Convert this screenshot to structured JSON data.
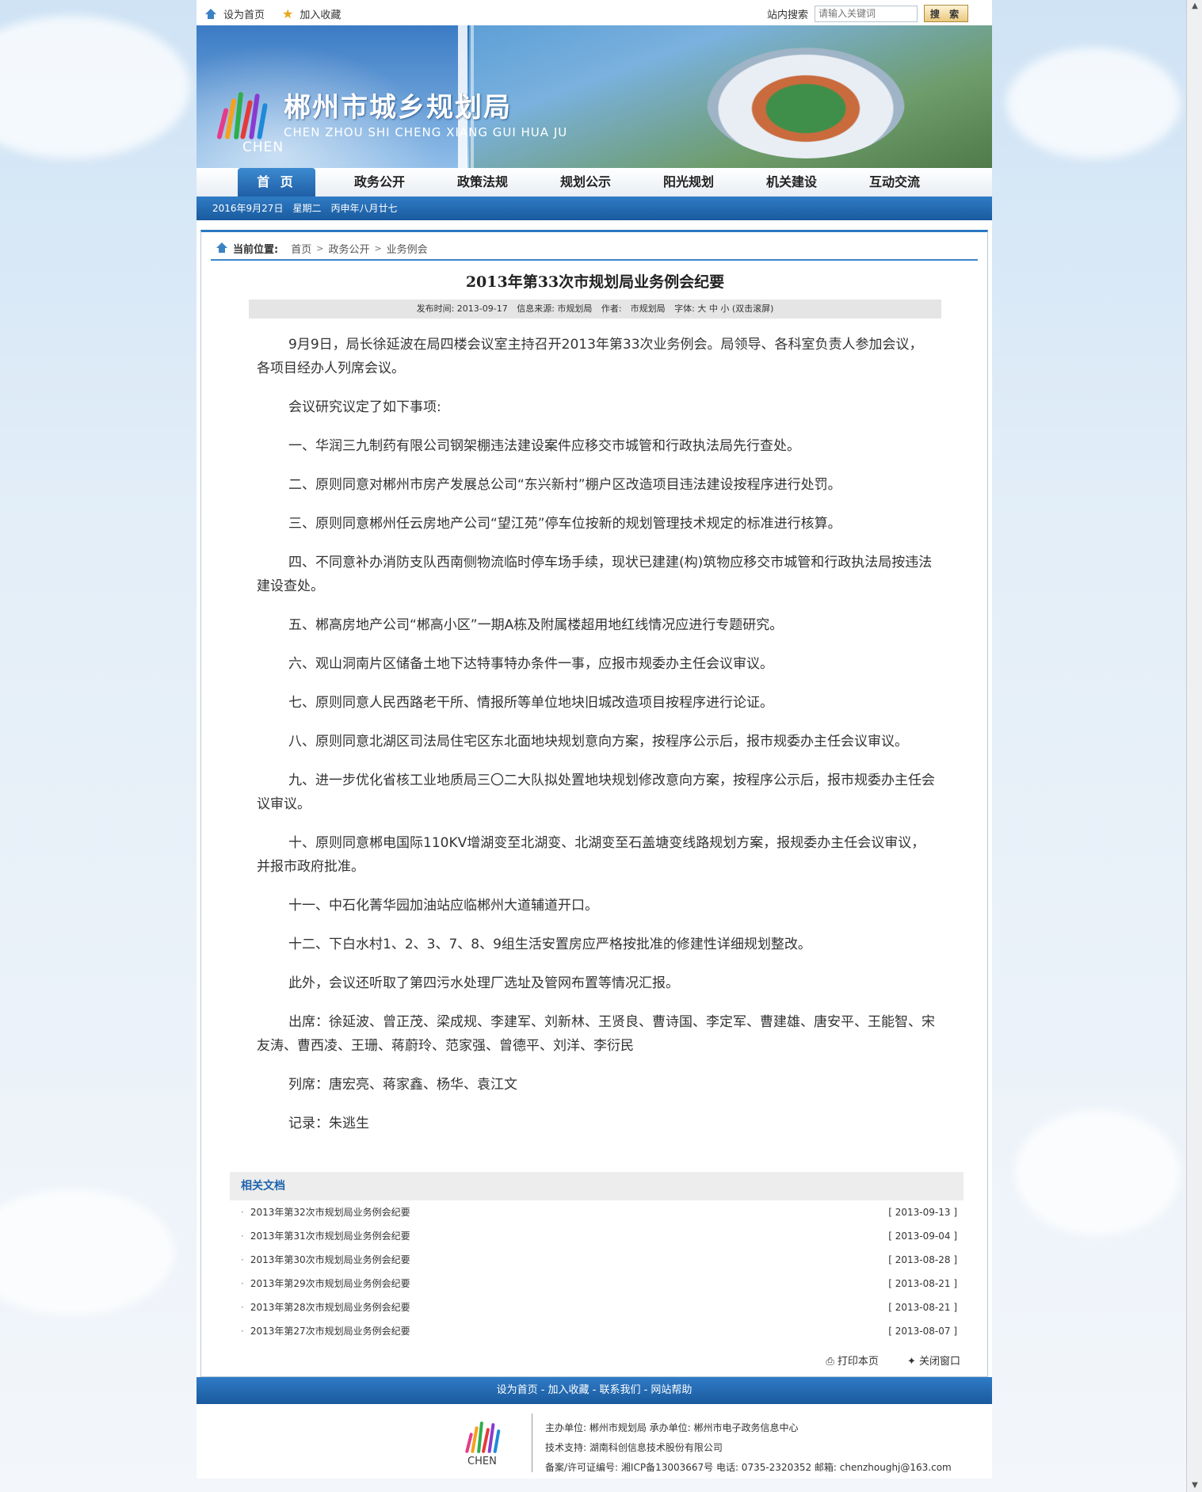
{
  "topbar": {
    "set_home": "设为首页",
    "favorite": "加入收藏",
    "search_label": "站内搜索",
    "search_placeholder": "请输入关键词",
    "search_button": "搜 索"
  },
  "banner": {
    "site_name": "郴州市城乡规划局",
    "site_pinyin": "CHEN ZHOU SHI CHENG XIANG GUI HUA JU",
    "logo_text": "CHEN"
  },
  "nav": {
    "items": [
      "首 页",
      "政务公开",
      "政策法规",
      "规划公示",
      "阳光规划",
      "机关建设",
      "互动交流"
    ],
    "active_index": 0
  },
  "datebar": "2016年9月27日　星期二　丙申年八月廿七",
  "breadcrumb": {
    "label": "当前位置:",
    "items": [
      "首页",
      "政务公开",
      "业务例会"
    ]
  },
  "article": {
    "title": "2013年第33次市规划局业务例会纪要",
    "meta": {
      "date": "发布时间: 2013-09-17",
      "source": "信息来源: 市规划局",
      "author": "作者:　市规划局",
      "font": "字体: 大 中 小 (双击滚屏)"
    },
    "paragraphs": [
      "9月9日，局长徐延波在局四楼会议室主持召开2013年第33次业务例会。局领导、各科室负责人参加会议，各项目经办人列席会议。",
      "会议研究议定了如下事项:",
      "一、华润三九制药有限公司钢架棚违法建设案件应移交市城管和行政执法局先行查处。",
      "二、原则同意对郴州市房产发展总公司“东兴新村”棚户区改造项目违法建设按程序进行处罚。",
      "三、原则同意郴州任云房地产公司“望江苑”停车位按新的规划管理技术规定的标准进行核算。",
      "四、不同意补办消防支队西南侧物流临时停车场手续，现状已建建(构)筑物应移交市城管和行政执法局按违法建设查处。",
      "五、郴高房地产公司“郴高小区”一期A栋及附属楼超用地红线情况应进行专题研究。",
      "六、观山洞南片区储备土地下达特事特办条件一事，应报市规委办主任会议审议。",
      "七、原则同意人民西路老干所、情报所等单位地块旧城改造项目按程序进行论证。",
      "八、原则同意北湖区司法局住宅区东北面地块规划意向方案，按程序公示后，报市规委办主任会议审议。",
      "九、进一步优化省核工业地质局三〇二大队拟处置地块规划修改意向方案，按程序公示后，报市规委办主任会议审议。",
      "十、原则同意郴电国际110KV增湖变至北湖变、北湖变至石盖塘变线路规划方案，报规委办主任会议审议，并报市政府批准。",
      "十一、中石化菁华园加油站应临郴州大道辅道开口。",
      "十二、下白水村1、2、3、7、8、9组生活安置房应严格按批准的修建性详细规划整改。",
      "此外，会议还听取了第四污水处理厂选址及管网布置等情况汇报。",
      "出席：徐延波、曾正茂、梁成规、李建军、刘新林、王贤良、曹诗国、李定军、曹建雄、唐安平、王能智、宋友涛、曹西凌、王珊、蒋蔚玲、范家强、曾德平、刘洋、李衍民",
      "列席：唐宏亮、蒋家鑫、杨华、袁江文",
      "记录：朱逃生"
    ]
  },
  "related": {
    "heading": "相关文档",
    "items": [
      {
        "title": "2013年第32次市规划局业务例会纪要",
        "date": "[ 2013-09-13 ]"
      },
      {
        "title": "2013年第31次市规划局业务例会纪要",
        "date": "[ 2013-09-04 ]"
      },
      {
        "title": "2013年第30次市规划局业务例会纪要",
        "date": "[ 2013-08-28 ]"
      },
      {
        "title": "2013年第29次市规划局业务例会纪要",
        "date": "[ 2013-08-21 ]"
      },
      {
        "title": "2013年第28次市规划局业务例会纪要",
        "date": "[ 2013-08-21 ]"
      },
      {
        "title": "2013年第27次市规划局业务例会纪要",
        "date": "[ 2013-08-07 ]"
      }
    ]
  },
  "tools": {
    "print": "打印本页",
    "close": "关闭窗口"
  },
  "footer": {
    "links": "设为首页 - 加入收藏 - 联系我们 - 网站帮助",
    "line1": "主办单位: 郴州市规划局  承办单位: 郴州市电子政务信息中心",
    "line2": "技术支持: 湖南科创信息技术股份有限公司",
    "line3": "备案/许可证编号: 湘ICP备13003667号 电话: 0735-2320352 邮箱: chenzhoughj@163.com",
    "logo_text": "CHEN"
  }
}
